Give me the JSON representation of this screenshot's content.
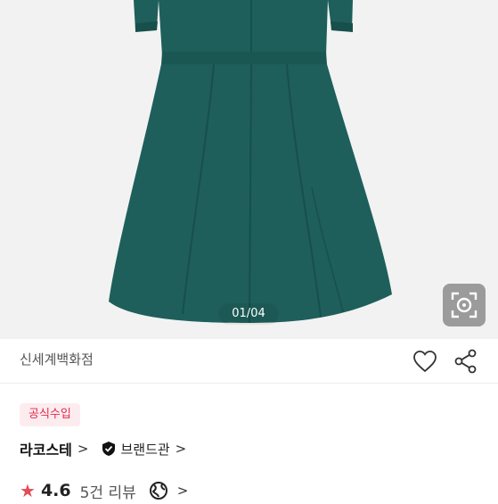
{
  "gallery": {
    "pager_text": "01/04",
    "dress_color": "#1e5f5b",
    "background_color": "#f2f2f2"
  },
  "seller": {
    "name": "신세계백화점"
  },
  "badge": {
    "label": "공식수입"
  },
  "brand": {
    "name": "라코스테",
    "brand_hall_label": "브랜드관",
    "chevron": ">"
  },
  "rating": {
    "score": "4.6",
    "review_count": "5건 리뷰",
    "chevron": ">"
  },
  "icons": [
    "image-search-icon",
    "heart-icon",
    "share-icon",
    "shield-check-icon",
    "star-icon",
    "globe-icon"
  ],
  "colors": {
    "accent_red": "#e0294a",
    "badge_bg": "#fdecef",
    "star": "#e34c55"
  }
}
